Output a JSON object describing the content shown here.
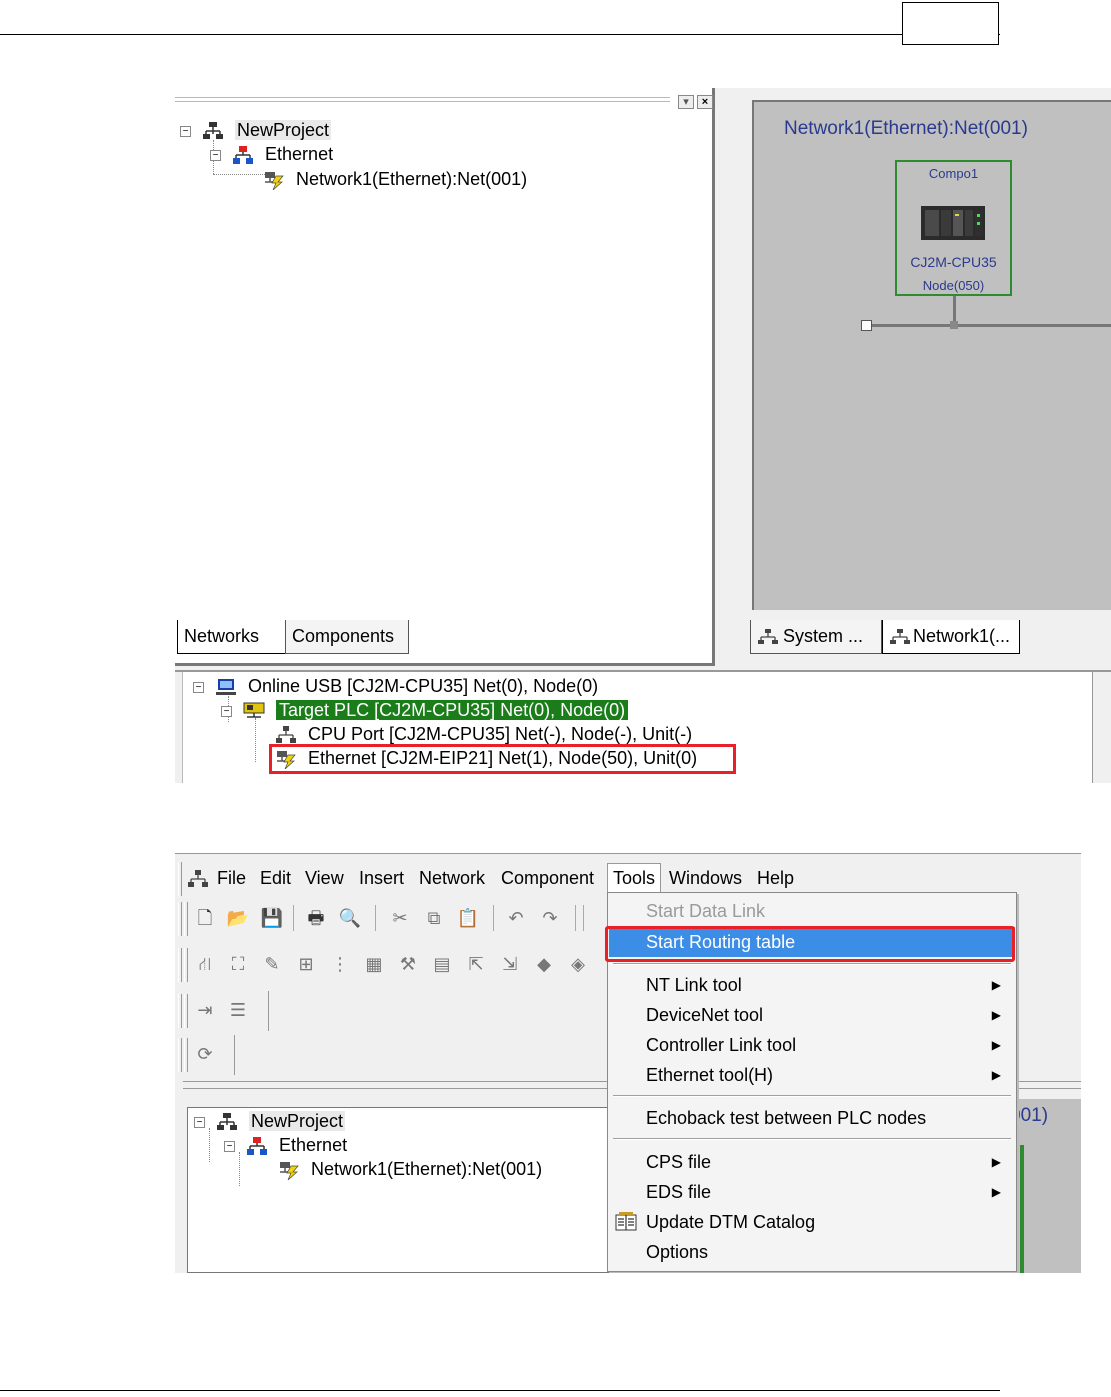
{
  "left_pane_tree": {
    "root": "NewProject",
    "child": "Ethernet",
    "leaf": "Network1(Ethernet):Net(001)"
  },
  "left_tabs": {
    "networks": "Networks",
    "components": "Components"
  },
  "network_view": {
    "title": "Network1(Ethernet):Net(001)",
    "node": {
      "name": "Compo1",
      "model": "CJ2M-CPU35",
      "address": "Node(050)"
    }
  },
  "right_tabs": {
    "system": "System ...",
    "network1": "Network1(..."
  },
  "online_tree": {
    "online": "Online USB  [CJ2M-CPU35] Net(0), Node(0)",
    "target": "Target PLC [CJ2M-CPU35] Net(0), Node(0)",
    "cpu_port": "CPU Port [CJ2M-CPU35] Net(-), Node(-), Unit(-)",
    "ethernet": "Ethernet [CJ2M-EIP21] Net(1), Node(50), Unit(0)"
  },
  "menubar": {
    "file": "File",
    "edit": "Edit",
    "view": "View",
    "insert": "Insert",
    "network": "Network",
    "component": "Component",
    "tools": "Tools",
    "windows": "Windows",
    "help": "Help"
  },
  "tools_menu": {
    "start_data_link": "Start Data Link",
    "start_routing_table": "Start Routing table",
    "nt_link_tool": "NT Link tool",
    "devicenet_tool": "DeviceNet tool",
    "controller_link_tool": "Controller Link tool",
    "ethernet_tool": "Ethernet tool(H)",
    "echoback_test": "Echoback test between PLC nodes",
    "cps_file": "CPS file",
    "eds_file": "EDS file",
    "update_dtm_catalog": "Update DTM Catalog",
    "options": "Options"
  },
  "tree2": {
    "root": "NewProject",
    "child": "Ethernet",
    "leaf": "Network1(Ethernet):Net(001)"
  },
  "canvas2_fragment": "001)",
  "colors": {
    "highlight_red": "#e8202a",
    "selection_green": "#1a7d1a",
    "menu_active_blue": "#3c8de6",
    "network_text_blue": "#2a3a8e",
    "node_border_green": "#2e8b2e"
  }
}
